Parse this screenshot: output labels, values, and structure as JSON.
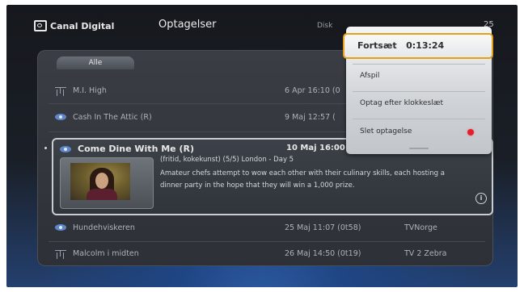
{
  "header": {
    "logo_text": "Canal Digital",
    "screen_title": "Optagelser",
    "disk_label": "Disk",
    "clock_partial": "25"
  },
  "filter_tab": {
    "label": "Alle"
  },
  "recordings": [
    {
      "icon": "antenna-icon",
      "title": "M.I. High",
      "date": "6 Apr 16:10 (0",
      "channel": ""
    },
    {
      "icon": "eye-icon",
      "title": "Cash In The Attic (R)",
      "date": "9 Maj 12:57 (",
      "channel": ""
    },
    {
      "icon": "eye-icon",
      "title": "Come Dine With Me (R)",
      "date": "10 Maj 16:00",
      "channel": "",
      "selected": true,
      "meta": "(fritid, kokekunst) (5/5) London - Day 5",
      "description": "Amateur chefs attempt to wow each other with their culinary skills, each hosting a dinner party in the hope that they will win a 1,000 prize."
    },
    {
      "icon": "eye-icon",
      "title": "Hundehviskeren",
      "date": "25 Maj 11:07 (0t58)",
      "channel": "TVNorge"
    },
    {
      "icon": "antenna-icon",
      "title": "Malcolm i midten",
      "date": "26 Maj 14:50 (0t19)",
      "channel": "TV 2 Zebra"
    }
  ],
  "context_menu": {
    "items": [
      {
        "label": "Fortsæt   0:13:24",
        "focused": true
      },
      {
        "label": "Afspil"
      },
      {
        "label": "Optag efter klokkeslæt"
      },
      {
        "label": "Slet optagelse",
        "icon": "record-icon",
        "icon_color": "#e0202c"
      }
    ],
    "focus_color": "#e2a019"
  },
  "info_icon": "i"
}
